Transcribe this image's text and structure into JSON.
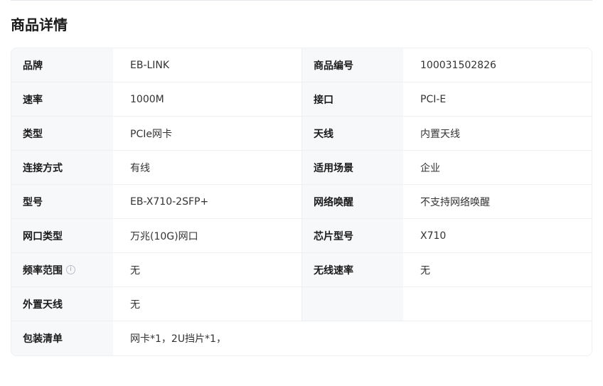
{
  "page_title": "商品详情",
  "rows": [
    {
      "label1": "品牌",
      "value1": "EB-LINK",
      "label2": "商品编号",
      "value2": "100031502826"
    },
    {
      "label1": "速率",
      "value1": "1000M",
      "label2": "接口",
      "value2": "PCI-E"
    },
    {
      "label1": "类型",
      "value1": "PCIe网卡",
      "label2": "天线",
      "value2": "内置天线"
    },
    {
      "label1": "连接方式",
      "value1": "有线",
      "label2": "适用场景",
      "value2": "企业"
    },
    {
      "label1": "型号",
      "value1": "EB-X710-2SFP+",
      "label2": "网络唤醒",
      "value2": "不支持网络唤醒"
    },
    {
      "label1": "网口类型",
      "value1": "万兆(10G)网口",
      "label2": "芯片型号",
      "value2": "X710"
    },
    {
      "label1": "频率范围",
      "value1": "无",
      "label2": "无线速率",
      "value2": "无",
      "info_icon": "info-icon"
    },
    {
      "label1": "外置天线",
      "value1": "无",
      "label2": "",
      "value2": ""
    },
    {
      "label1": "包装清单",
      "value1": "网卡*1，2U挡片*1，"
    }
  ],
  "info_icon_glyph": "i"
}
